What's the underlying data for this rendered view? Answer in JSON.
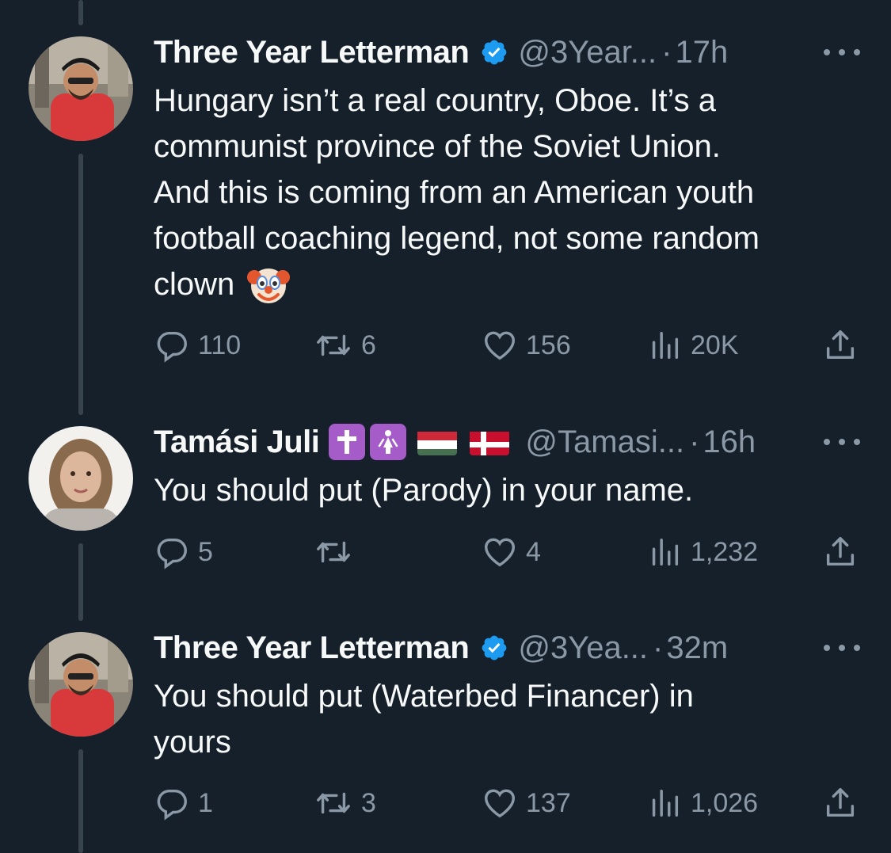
{
  "tweets": [
    {
      "name": "Three Year Letterman",
      "handle": "@3Year...",
      "time": "17h",
      "text_lines": [
        "Hungary isn’t a real country, Oboe. It’s a",
        "communist province of the Soviet Union.",
        "And this is coming from an American youth",
        "football coaching legend, not some random",
        "clown"
      ],
      "emoji": "clown-face",
      "replies": "110",
      "retweets": "6",
      "likes": "156",
      "views": "20K"
    },
    {
      "name": "Tamási Juli",
      "badges": [
        "latin-cross",
        "womens-symbol",
        "flag-hungary",
        "flag-denmark"
      ],
      "handle": "@Tamasi...",
      "time": "16h",
      "text_lines": [
        "You should put (Parody) in your name."
      ],
      "replies": "5",
      "retweets": "",
      "likes": "4",
      "views": "1,232"
    },
    {
      "name": "Three Year Letterman",
      "handle": "@3Yea...",
      "time": "32m",
      "text_lines": [
        "You should put (Waterbed Financer) in",
        "yours"
      ],
      "replies": "1",
      "retweets": "3",
      "likes": "137",
      "views": "1,026"
    }
  ],
  "dot_separator": "·",
  "colors": {
    "background": "#15202b",
    "text": "#f7f9f9",
    "secondary": "#8b98a5",
    "thread_line": "#38444d",
    "verified": "#1d9bf0",
    "badge_purple": "#a55cc9"
  }
}
